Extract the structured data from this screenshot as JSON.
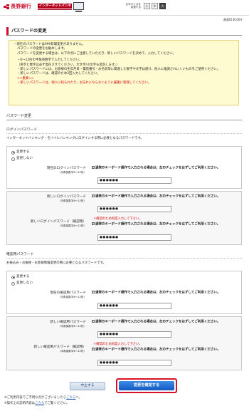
{
  "header": {
    "bank_name": "長野銀行",
    "service_banner": "インターネットバンキング",
    "font_size_label": "文字サイズを変更する",
    "font_sizes": [
      "小",
      "中",
      "大"
    ],
    "font_size_selected": "大"
  },
  "screen_id": "画面ID:EL004",
  "page_title": "パスワードの変更",
  "notice": {
    "lines": [
      "・現在のパスワードは999日間変更がありません。",
      "パスワードの変更をお勧めします。",
      "パスワードを変更する場合は、以下の点にご注意していただき、新しいパスワードを決めて、入力してください。",
      "・6～12桁の半角英数字で入力してください。",
      "（英字と数字は必ず混在させてください。大文字/小文字も区別します。）",
      "・新しいパスワードには、お客様の生年月日・電話番号・お名前等に関連した数字や文字は避け、他人に推測されにくいものをご使用ください。",
      "・新しいパスワードは、確認のため2回入力してください。",
      "<<重要>>",
      "・新しいパスワードは、他人に知られたり、お忘れにならないように厳重に管理してください。"
    ]
  },
  "section_title": "パスワード変更",
  "login_section": {
    "title": "ログインパスワード",
    "description": "インターネットバンキング・モバイルバンキングにログインする際に必要となるパスワードです。",
    "options": [
      "変更する",
      "変更しない"
    ],
    "selected": "変更する",
    "current_label": "現在のログインパスワード",
    "new_label": "新しいログインパスワード",
    "confirm_label": "新しいログインパスワード（確認用）",
    "hint": "（半角英数字6～12桁）",
    "checkbox_text": "通常のキーボード操作で入力される場合は、左のチェックをはずしてご利用ください。",
    "masked_value": "●●●●●●",
    "error_text": "＊確認のため再度入力して下さい。"
  },
  "confirm_section": {
    "title": "確認用パスワード",
    "description": "お振込み・お振替・お客様情報変更の際に必要となるパスワードです。",
    "options": [
      "変更する",
      "変更しない"
    ],
    "selected": "変更する",
    "current_label": "現在の確認用パスワード",
    "new_label": "新しい確認用パスワード",
    "confirm_label": "新しい確認用パスワード（確認用）",
    "hint": "（半角英数字6～12桁）",
    "checkbox_text": "通常のキーボード操作で入力される場合は、左のチェックをはずしてご利用ください。",
    "masked_value": "●●●●●●",
    "error_text": "＊確認のため再度入力して下さい。"
  },
  "buttons": {
    "cancel": "中止する",
    "confirm": "変更を確定する"
  },
  "footer": {
    "line1_prefix": "※ご利用内容でご不明な点がございましたら",
    "line1_link": "こちら",
    "line1_suffix": "へ。",
    "line2_prefix": "※操作上の説明内容は",
    "line2_link": "こちら",
    "line2_suffix": "でご覧ください。"
  }
}
